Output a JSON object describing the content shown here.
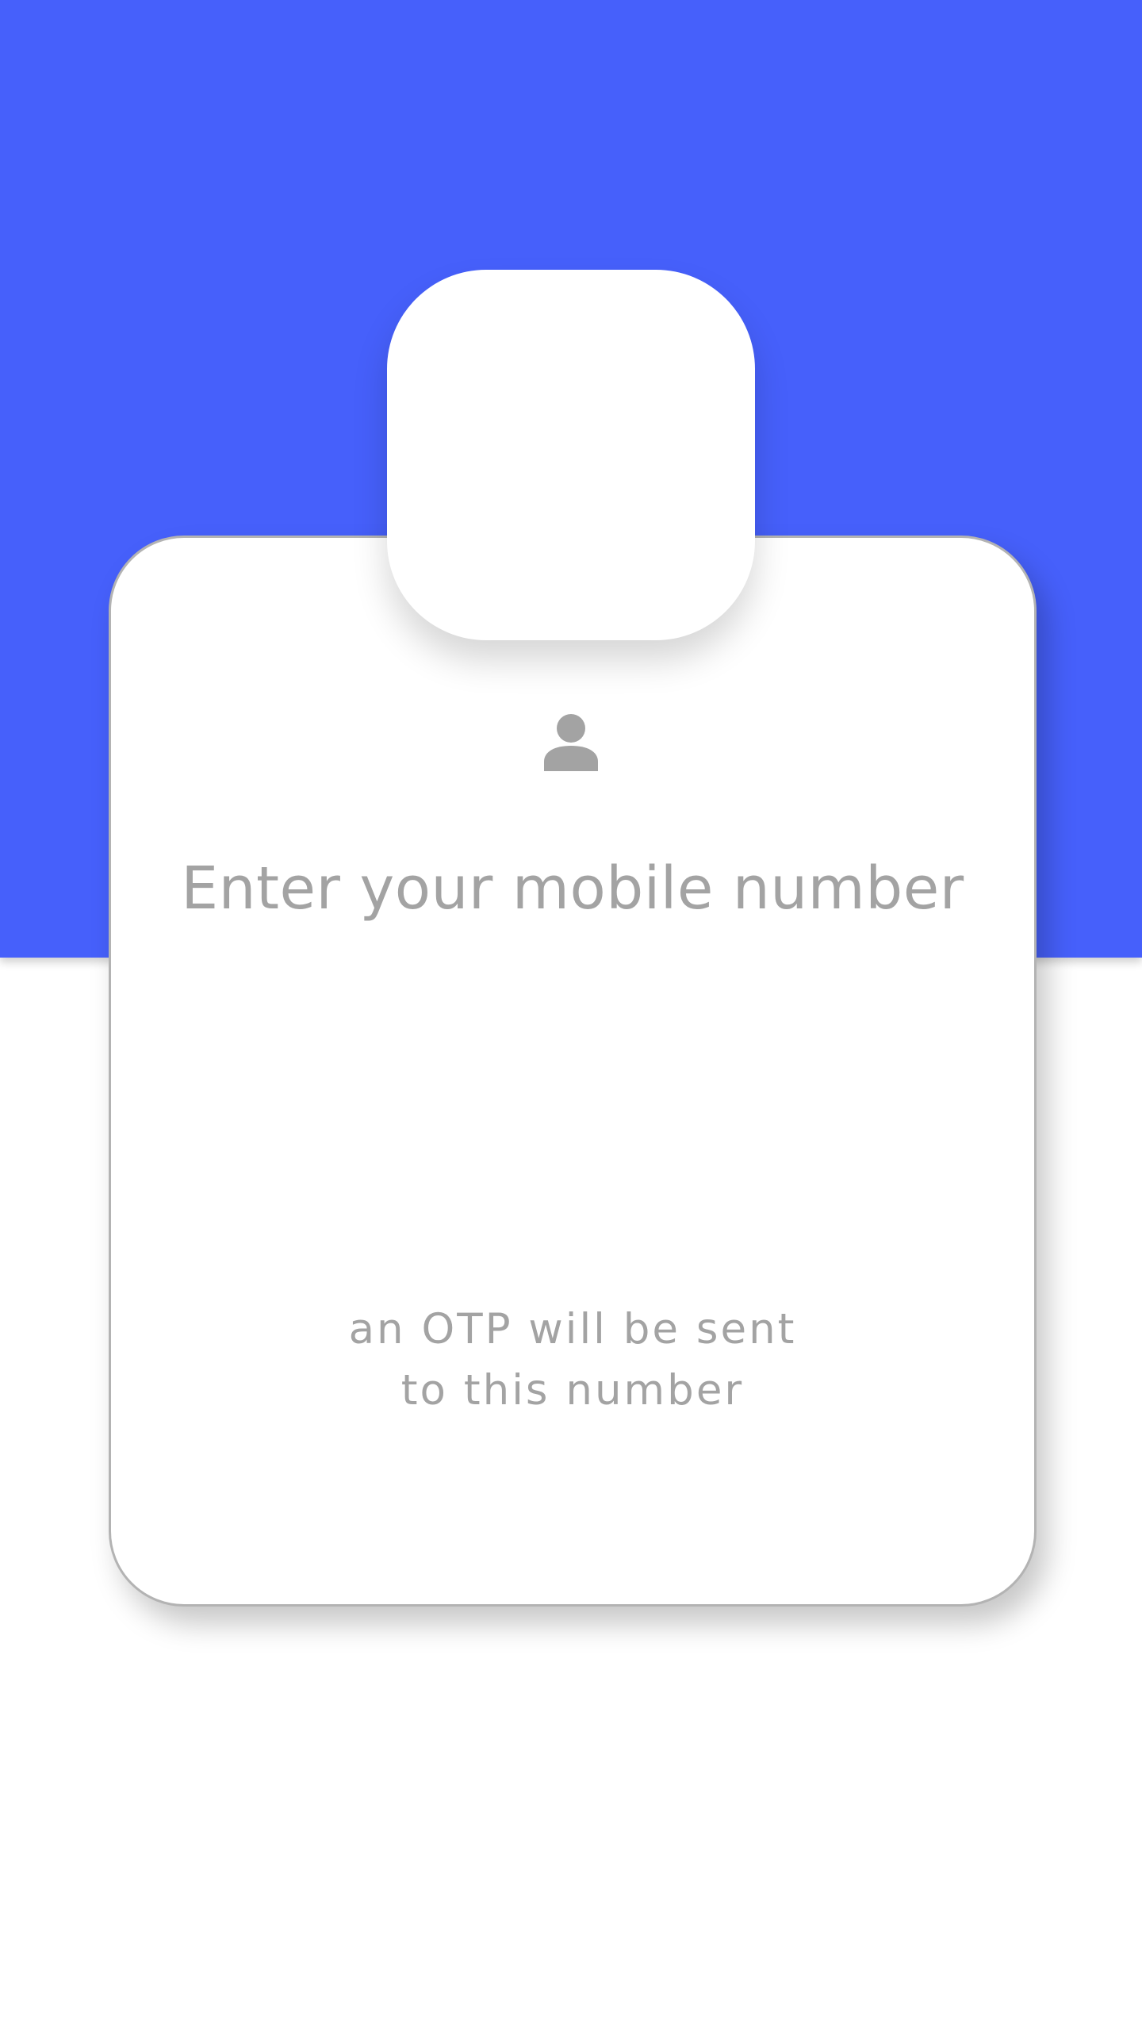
{
  "colors": {
    "brand_blue": "#4660fb",
    "card_border": "#b3b3b3",
    "text_gray": "#a3a3a3"
  },
  "login": {
    "icon": "person-icon",
    "title": "Enter your mobile number",
    "hint_line1": "an OTP will be sent",
    "hint_line2": "to this number"
  }
}
